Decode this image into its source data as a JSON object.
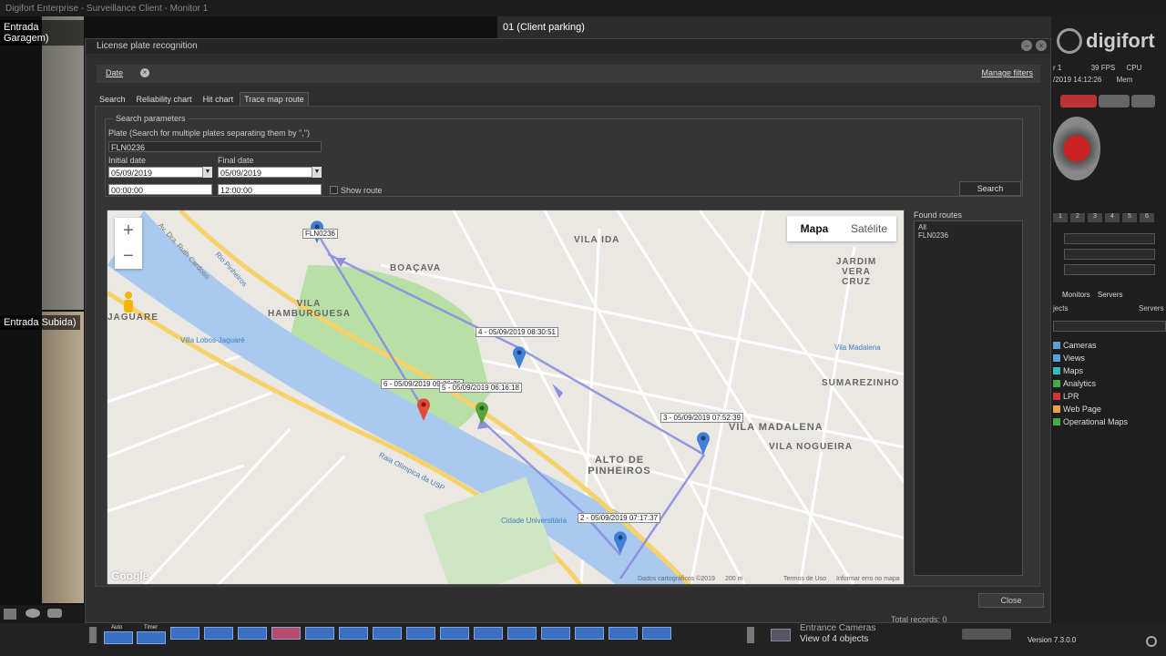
{
  "app_title": "Digifort Enterprise - Surveillance Client - Monitor 1",
  "cameras": {
    "entrada_garagem": "Entrada Garagem)",
    "client_parking": "01 (Client parking)",
    "entrada_subida": "Entrada Subida)"
  },
  "logo": "digifort",
  "stats": {
    "monitor": "r 1",
    "fps": "39 FPS",
    "cpu": "CPU",
    "datetime": "/2019 14:12:26",
    "mem": "Mem"
  },
  "dialog": {
    "title": "License plate recognition",
    "filter_tag": "Date",
    "manage_filters": "Manage filters",
    "tabs": [
      {
        "label": "Search"
      },
      {
        "label": "Reliability chart"
      },
      {
        "label": "Hit chart"
      },
      {
        "label": "Trace map route"
      }
    ],
    "search_parameters": "Search parameters",
    "plate_label": "Plate (Search for multiple plates separating them by \",\")",
    "plate_value": "FLN0236",
    "initial_date_label": "Initial date",
    "initial_date": "05/09/2019",
    "final_date_label": "Final date",
    "final_date": "05/09/2019",
    "initial_time": "00:00:00",
    "final_time": "12:00:00",
    "show_route": "Show route",
    "search_button": "Search",
    "found_routes_label": "Found routes",
    "found_routes": [
      "All",
      "FLN0236"
    ],
    "close_button": "Close",
    "total_records": "Total records: 0"
  },
  "map": {
    "map_type": {
      "map": "Mapa",
      "satellite": "Satélite"
    },
    "zoom_in": "+",
    "zoom_out": "−",
    "route_labels": [
      {
        "text": "FLN0236"
      },
      {
        "text": "4 - 05/09/2019 08:30:51"
      },
      {
        "text": "6 - 05/09/2019 09:26:26"
      },
      {
        "text": "5 - 05/09/2019 06:16:18"
      },
      {
        "text": "3 - 05/09/2019 07:52:39"
      },
      {
        "text": "2 - 05/09/2019 07:17:37"
      }
    ],
    "places": {
      "vila_ida": "VILA IDA",
      "boacava": "BOAÇAVA",
      "vila_hamburguesa": "VILA HAMBURGUESA",
      "jardim_vera_cruz": "JARDIM VERA CRUZ",
      "sumarezinho": "SUMAREZINHO",
      "vila_madalena": "VILA MADALENA",
      "vila_nogueira": "VILA NOGUEIRA",
      "alto_de_pinheiros": "ALTO DE PINHEIROS",
      "jaguare": "JAGUARE",
      "villa_lobos": "Villa Lobos-Jaguaré",
      "vila_madalena_station": "Vila Madalena",
      "cidade_universitaria": "Cidade Universitária",
      "rio_pinheiros": "Rio Pinheiros",
      "raia_olimpica": "Raia Olímpica da USP",
      "av_ruth_cardoso": "Av. Dra. Ruth Cardoso"
    },
    "attribution": "Dados cartográficos ©2019",
    "scale": "200 m",
    "terms": "Termos de Uso",
    "report": "Informar erro no mapa",
    "google": "Google"
  },
  "tree": [
    "Cameras",
    "Views",
    "Maps",
    "Analytics",
    "LPR",
    "Web Page",
    "Operational Maps"
  ],
  "panel_tabs": {
    "monitors": "Monitors",
    "servers": "Servers",
    "objects": "jects",
    "servers_radio": "Servers"
  },
  "bottom": {
    "auto": "Auto",
    "timer": "Timer",
    "view_name": "Entrance Cameras",
    "view_objects": "View of 4 objects",
    "version": "Version 7.3.0.0"
  }
}
